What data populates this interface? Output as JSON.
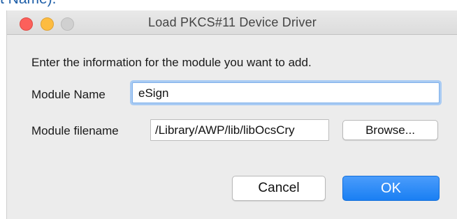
{
  "fragment_text": "t Name).",
  "dialog": {
    "title": "Load PKCS#11 Device Driver",
    "intro": "Enter the information for the module you want to add.",
    "module_name_label": "Module Name",
    "module_name_value": "eSign",
    "module_filename_label": "Module filename",
    "module_filename_value": "/Library/AWP/lib/libOcsCry",
    "browse_label": "Browse...",
    "cancel_label": "Cancel",
    "ok_label": "OK"
  },
  "colors": {
    "close": "#fc605b",
    "minimize": "#fdbc40",
    "maximize_disabled": "#d0d0d0",
    "accent": "#1a7ff3",
    "focus_ring": "#a9cbf3"
  }
}
